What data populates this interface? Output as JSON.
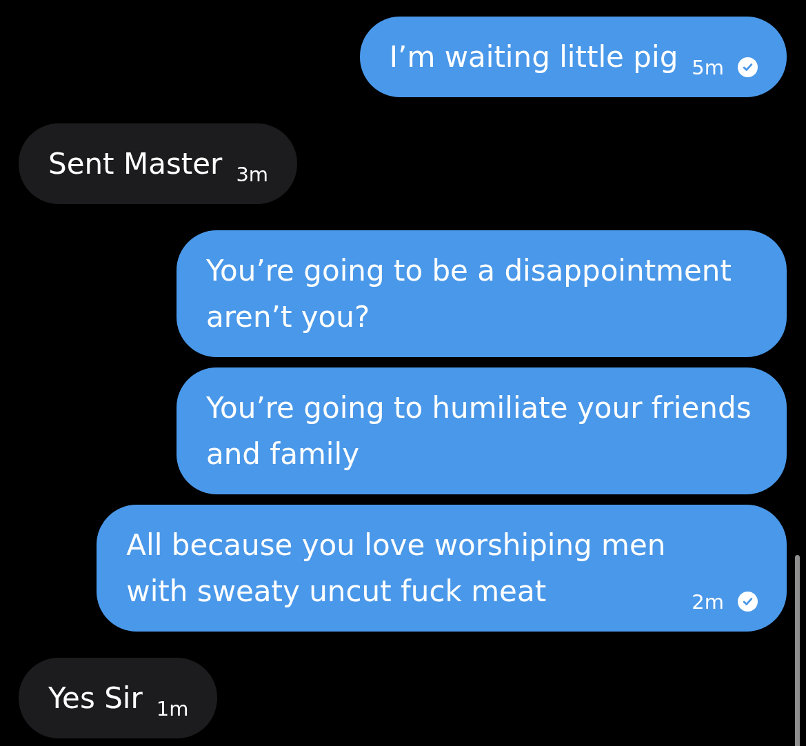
{
  "messages": [
    {
      "kind": "outgoing",
      "text": "I’m waiting little pig",
      "time": "5m",
      "seen": true
    },
    {
      "kind": "incoming",
      "text": "Sent Master",
      "time": "3m"
    },
    {
      "kind": "outgoing",
      "text": "You’re going to be a disappointment aren’t you?"
    },
    {
      "kind": "outgoing",
      "text": "You’re going to humiliate your friends and family"
    },
    {
      "kind": "outgoing",
      "text": "All because you love worshiping men with sweaty uncut fuck meat",
      "time": "2m",
      "seen": true
    },
    {
      "kind": "incoming",
      "text": "Yes Sir",
      "time": "1m"
    }
  ]
}
